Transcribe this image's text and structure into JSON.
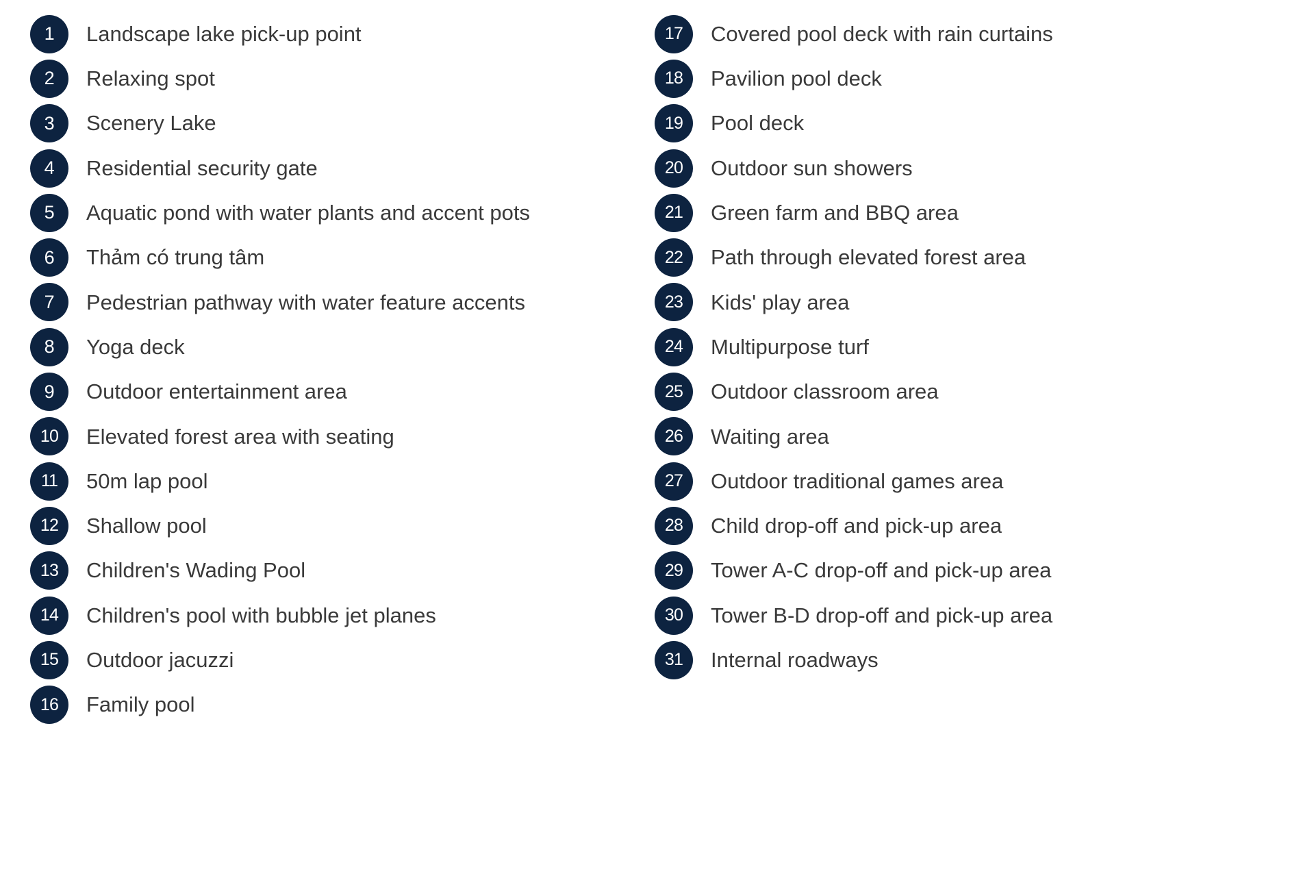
{
  "legend": {
    "accent_color": "#0d2340",
    "badge_text_color": "#ffffff",
    "label_color": "#3a3a3a",
    "background_color": "#ffffff",
    "columns": [
      {
        "name": "left-column",
        "items": [
          {
            "number": "1",
            "label": "Landscape lake pick-up point"
          },
          {
            "number": "2",
            "label": "Relaxing spot"
          },
          {
            "number": "3",
            "label": "Scenery Lake"
          },
          {
            "number": "4",
            "label": "Residential security gate"
          },
          {
            "number": "5",
            "label": "Aquatic pond with water plants and accent pots"
          },
          {
            "number": "6",
            "label": "Thảm có trung tâm"
          },
          {
            "number": "7",
            "label": "Pedestrian pathway with water feature accents"
          },
          {
            "number": "8",
            "label": "Yoga deck"
          },
          {
            "number": "9",
            "label": "Outdoor entertainment area"
          },
          {
            "number": "10",
            "label": "Elevated forest area with seating"
          },
          {
            "number": "11",
            "label": "50m lap pool"
          },
          {
            "number": "12",
            "label": "Shallow pool"
          },
          {
            "number": "13",
            "label": "Children's Wading Pool"
          },
          {
            "number": "14",
            "label": "Children's pool with bubble jet planes"
          },
          {
            "number": "15",
            "label": "Outdoor jacuzzi"
          },
          {
            "number": "16",
            "label": "Family pool"
          }
        ]
      },
      {
        "name": "right-column",
        "items": [
          {
            "number": "17",
            "label": "Covered pool deck with rain curtains"
          },
          {
            "number": "18",
            "label": "Pavilion pool deck"
          },
          {
            "number": "19",
            "label": "Pool deck"
          },
          {
            "number": "20",
            "label": "Outdoor sun showers"
          },
          {
            "number": "21",
            "label": "Green farm and BBQ area"
          },
          {
            "number": "22",
            "label": "Path through elevated forest area"
          },
          {
            "number": "23",
            "label": "Kids' play area"
          },
          {
            "number": "24",
            "label": "Multipurpose turf"
          },
          {
            "number": "25",
            "label": "Outdoor classroom area"
          },
          {
            "number": "26",
            "label": "Waiting area"
          },
          {
            "number": "27",
            "label": "Outdoor traditional games area"
          },
          {
            "number": "28",
            "label": "Child drop-off and pick-up area"
          },
          {
            "number": "29",
            "label": "Tower A-C drop-off and pick-up area"
          },
          {
            "number": "30",
            "label": "Tower B-D drop-off and pick-up area"
          },
          {
            "number": "31",
            "label": "Internal roadways"
          }
        ]
      }
    ]
  }
}
